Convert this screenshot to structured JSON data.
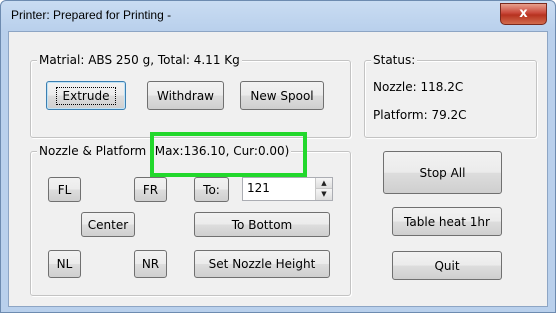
{
  "window": {
    "title": "Printer: Prepared for Printing -",
    "close_glyph": "x"
  },
  "material_group": {
    "legend": "Matrial: ABS 250 g,  Total: 4.11 Kg",
    "buttons": {
      "extrude": "Extrude",
      "withdraw": "Withdraw",
      "new_spool": "New Spool"
    }
  },
  "status_group": {
    "legend": "Status:",
    "nozzle": "Nozzle: 118.2C",
    "platform": "Platform: 79.2C"
  },
  "nozzle_group": {
    "legend": "Nozzle & Platform (Max:136.10, Cur:0.00)",
    "buttons": {
      "fl": "FL",
      "fr": "FR",
      "to": "To:",
      "center": "Center",
      "to_bottom": "To Bottom",
      "nl": "NL",
      "nr": "NR",
      "set_nozzle_height": "Set Nozzle Height"
    },
    "height_input": {
      "value": "121"
    }
  },
  "side_buttons": {
    "stop_all": "Stop All",
    "table_heat": "Table heat 1hr",
    "quit": "Quit"
  },
  "icons": {
    "spin_up": "▲",
    "spin_down": "▼"
  },
  "colors": {
    "highlight": "#22d82c",
    "close_button": "#c9473a"
  }
}
